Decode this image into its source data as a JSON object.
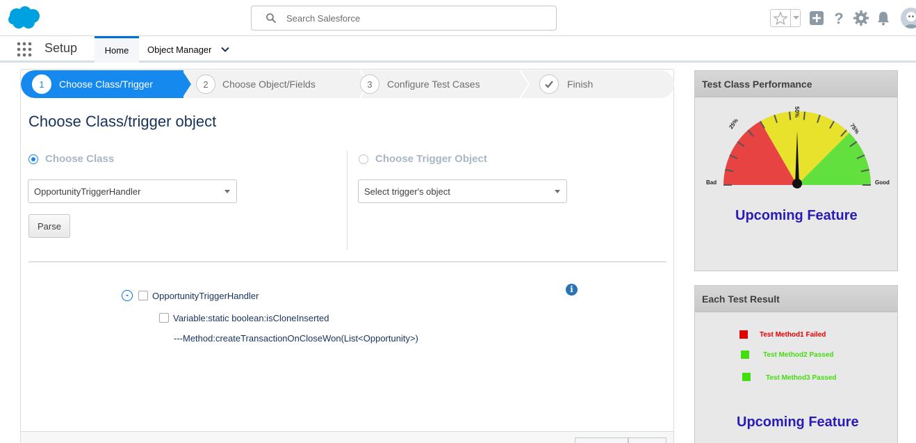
{
  "header": {
    "logo": "salesforce-cloud-logo",
    "search_placeholder": "Search Salesforce",
    "icons": [
      "favorites-star-icon",
      "add-icon",
      "help-icon",
      "setup-gear-icon",
      "notifications-bell-icon",
      "avatar"
    ]
  },
  "context_bar": {
    "app_name": "Setup",
    "tabs": [
      {
        "label": "Home",
        "active": true
      },
      {
        "label": "Object Manager",
        "active": false
      }
    ]
  },
  "wizard": {
    "steps": [
      {
        "number": "1",
        "label": "Choose Class/Trigger",
        "active": true
      },
      {
        "number": "2",
        "label": "Choose Object/Fields",
        "active": false
      },
      {
        "number": "3",
        "label": "Configure Test Cases",
        "active": false
      },
      {
        "number": "",
        "label": "Finish",
        "active": false,
        "icon": "checkmark-icon"
      }
    ]
  },
  "main": {
    "heading": "Choose Class/trigger object",
    "class_option": {
      "label": "Choose Class",
      "checked": true,
      "selected_value": "OpportunityTriggerHandler"
    },
    "trigger_option": {
      "label": "Choose Trigger Object",
      "checked": false,
      "selected_value": "Select trigger's object"
    },
    "parse_label": "Parse",
    "tree": {
      "toggle": "-",
      "root": "OpportunityTriggerHandler",
      "children": [
        {
          "label": "Variable:static boolean:isCloneInserted",
          "checkbox": true
        },
        {
          "label": "---Method:createTransactionOnCloseWon(List<Opportunity>)",
          "checkbox": false
        }
      ]
    },
    "info_icon": "i"
  },
  "performance_card": {
    "title": "Test Class Performance",
    "gauge": {
      "ticks": [
        "25%",
        "50%",
        "75%"
      ],
      "left_label": "Bad",
      "right_label": "Good",
      "colors": {
        "bad": "#e84343",
        "mid": "#e8e22c",
        "good": "#62e03e"
      }
    },
    "upcoming": "Upcoming Feature"
  },
  "result_card": {
    "title": "Each Test Result",
    "results": [
      {
        "label": "Test Method1 Failed",
        "color": "#e00000"
      },
      {
        "label": "Test Method2 Passed",
        "color": "#44dd11"
      },
      {
        "label": "Test Method3 Passed",
        "color": "#44dd11"
      }
    ],
    "upcoming": "Upcoming Feature"
  }
}
